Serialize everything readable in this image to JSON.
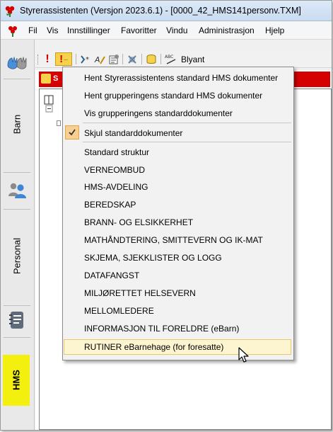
{
  "window": {
    "title": "Styrerassistenten (Versjon 2023.6.1) - [0000_42_HMS141personv.TXM]"
  },
  "menubar": {
    "items": [
      "Fil",
      "Vis",
      "Innstillinger",
      "Favoritter",
      "Vindu",
      "Administrasjon",
      "Hjelp"
    ]
  },
  "sidebar": {
    "items": [
      {
        "label": "Barn",
        "icon": "hands-icon"
      },
      {
        "label": "Personal",
        "icon": "people-icon"
      },
      {
        "label": "HMS",
        "icon": "notebook-icon"
      }
    ],
    "hms_color": "#f3f010"
  },
  "toolbar": {
    "pencil_label": "Blyant"
  },
  "doc": {
    "tab_letter": "S",
    "header_color": "#d50000"
  },
  "dropdown": {
    "group1": [
      "Hent Styrerassistentens standard HMS dokumenter",
      "Hent grupperingens standard HMS dokumenter",
      "Vis grupperingens standarddokumenter"
    ],
    "checked_item": "Skjul standarddokumenter",
    "group3": [
      "Standard struktur",
      "VERNEOMBUD",
      "HMS-AVDELING",
      "BEREDSKAP",
      "BRANN- OG ELSIKKERHET",
      "MATHÅNDTERING,  SMITTEVERN OG IK-MAT",
      "SKJEMA, SJEKKLISTER OG LOGG",
      "DATAFANGST",
      "MILJØRETTET HELSEVERN",
      "MELLOMLEDERE",
      "INFORMASJON TIL FORELDRE (eBarn)"
    ],
    "highlighted_item": "RUTINER eBarnehage (for foresatte)",
    "highlight_color": "#fdf5d0",
    "check_color": "#f7cf90"
  }
}
